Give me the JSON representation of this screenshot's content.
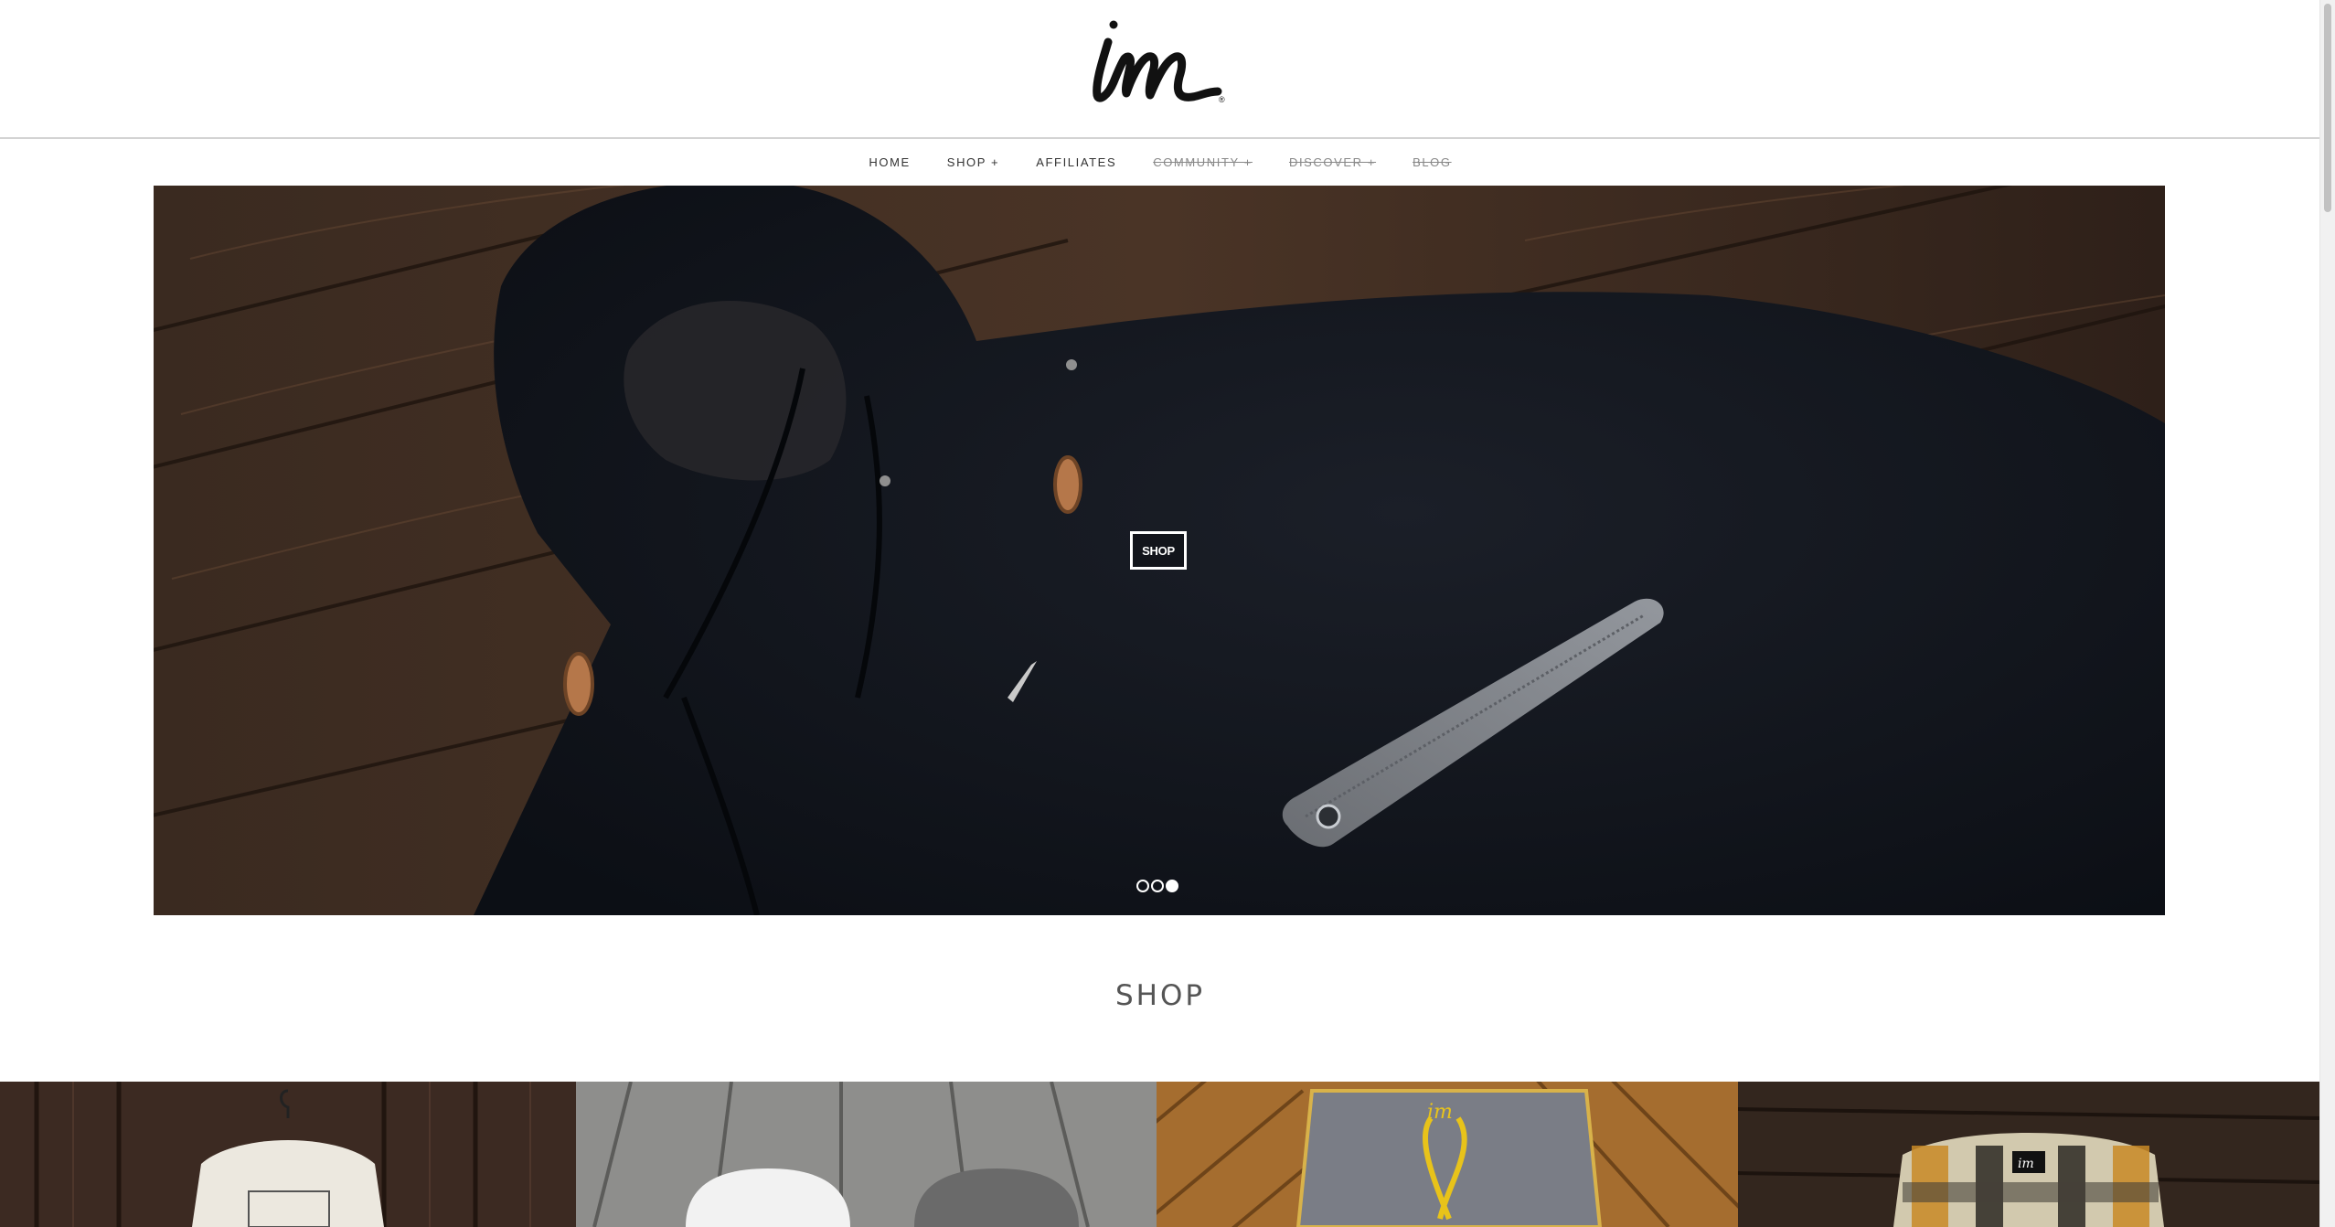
{
  "brand": {
    "logo_text": "im",
    "registered_mark": "®"
  },
  "nav": {
    "items": [
      {
        "label": "HOME",
        "struck": false
      },
      {
        "label": "SHOP +",
        "struck": false
      },
      {
        "label": "AFFILIATES",
        "struck": false
      },
      {
        "label": "COMMUNITY +",
        "struck": true
      },
      {
        "label": "DISCOVER +",
        "struck": true
      },
      {
        "label": "BLOG",
        "struck": true
      }
    ]
  },
  "hero": {
    "button_label": "SHOP",
    "slides_total": 3,
    "active_slide": 3,
    "image_subject": "black hooded jacket on dark wood floor"
  },
  "shop_section": {
    "title": "SHOP"
  },
  "products": [
    {
      "name": "tee-shirt-tile",
      "subject": "white tee on hanger over dark wood"
    },
    {
      "name": "caps-tile",
      "subject": "white and grey caps on grey wood planks"
    },
    {
      "name": "boardshorts-tile",
      "subject": "grey boardshorts on diagonal wood"
    },
    {
      "name": "flannel-tile",
      "subject": "plaid flannel shirt on dark wood"
    }
  ],
  "colors": {
    "nav_text": "#333333",
    "nav_struck": "#888888",
    "divider": "#d3d3d3",
    "accent_yellow": "#e8c31a"
  }
}
